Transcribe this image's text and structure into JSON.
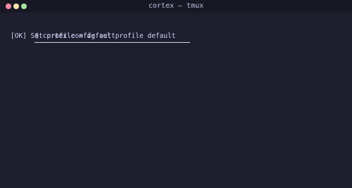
{
  "window": {
    "title": "cortex — tmux"
  },
  "terminal": {
    "command": "$ cortex config set profile default",
    "output": "[OK] Set profile = default"
  }
}
